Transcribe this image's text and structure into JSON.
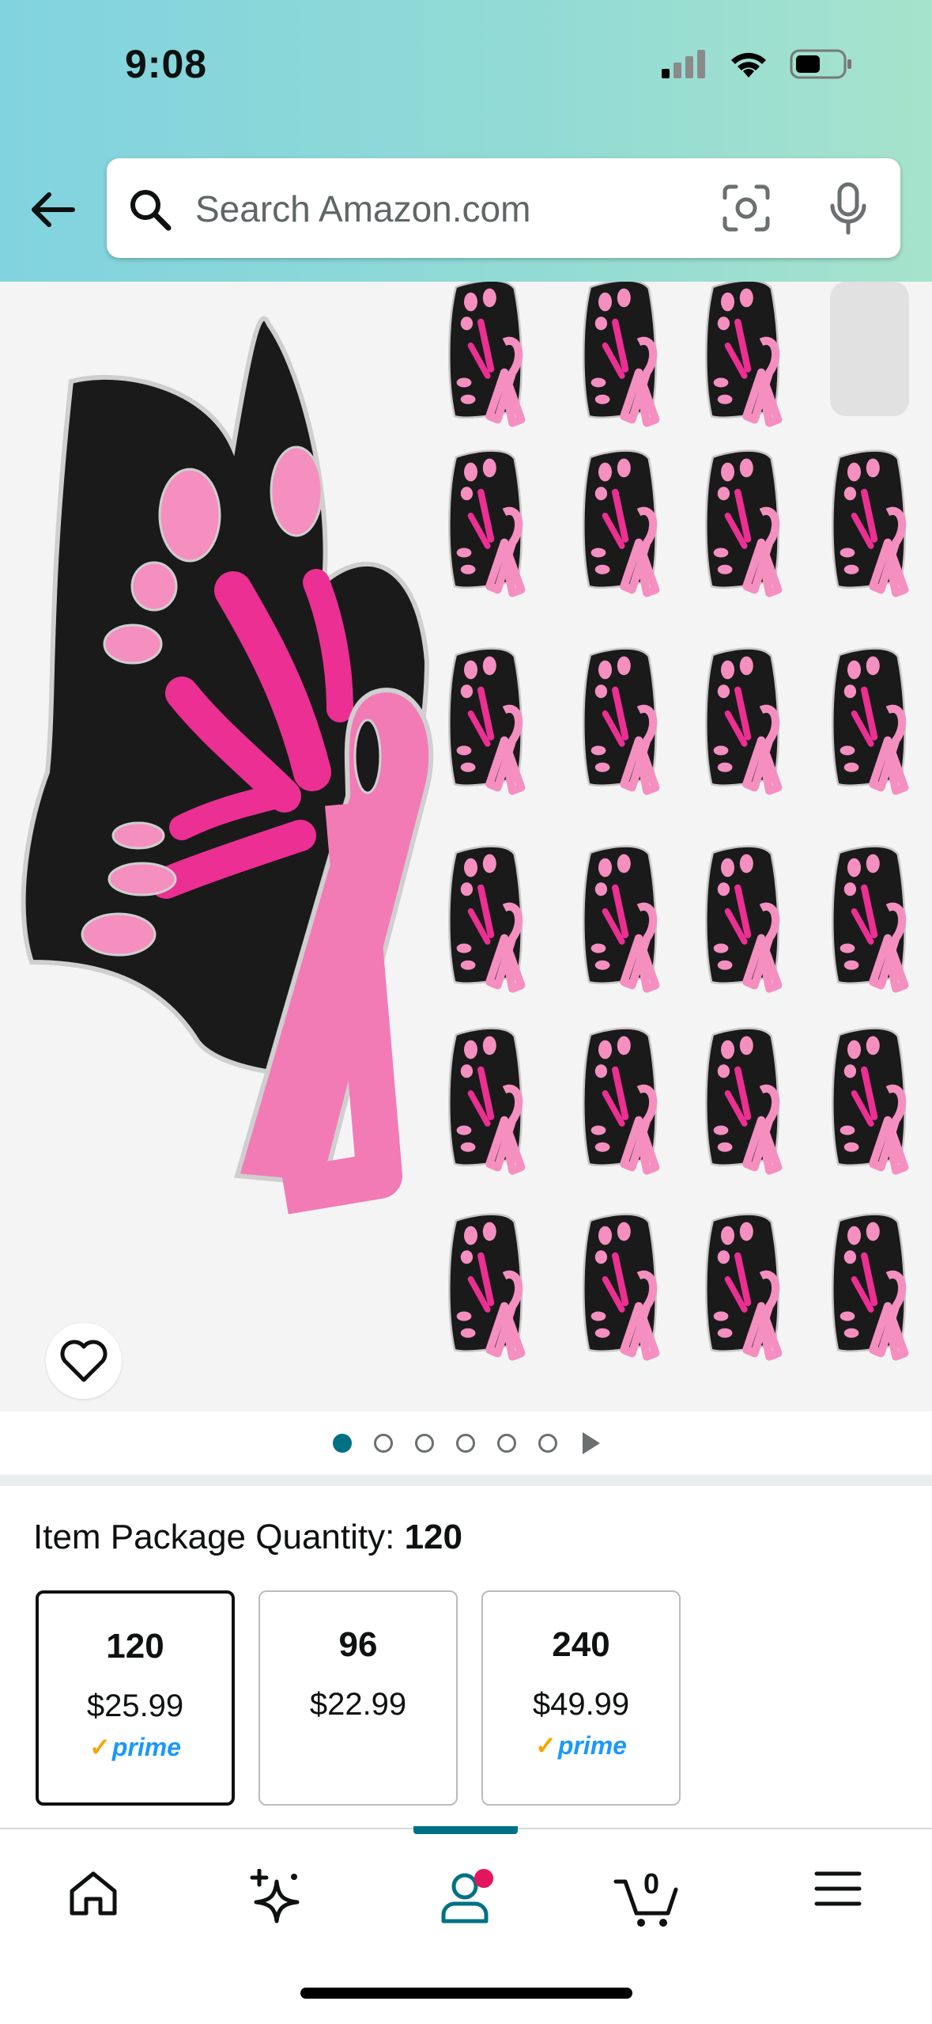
{
  "status_bar": {
    "time": "9:08"
  },
  "search": {
    "placeholder": "Search Amazon.com"
  },
  "gallery": {
    "image_count": 6,
    "active_index": 0
  },
  "quantity": {
    "label": "Item Package Quantity:",
    "selected": "120",
    "options": [
      {
        "qty": "120",
        "price": "$25.99",
        "prime": "prime"
      },
      {
        "qty": "96",
        "price": "$22.99",
        "prime": ""
      },
      {
        "qty": "240",
        "price": "$49.99",
        "prime": "prime"
      }
    ]
  },
  "tabbar": {
    "cart_count": "0",
    "active_tab": "account"
  },
  "colors": {
    "accent": "#007185",
    "pink": "#f27bb5",
    "magenta": "#ec2f93",
    "badge": "#e3165b"
  }
}
